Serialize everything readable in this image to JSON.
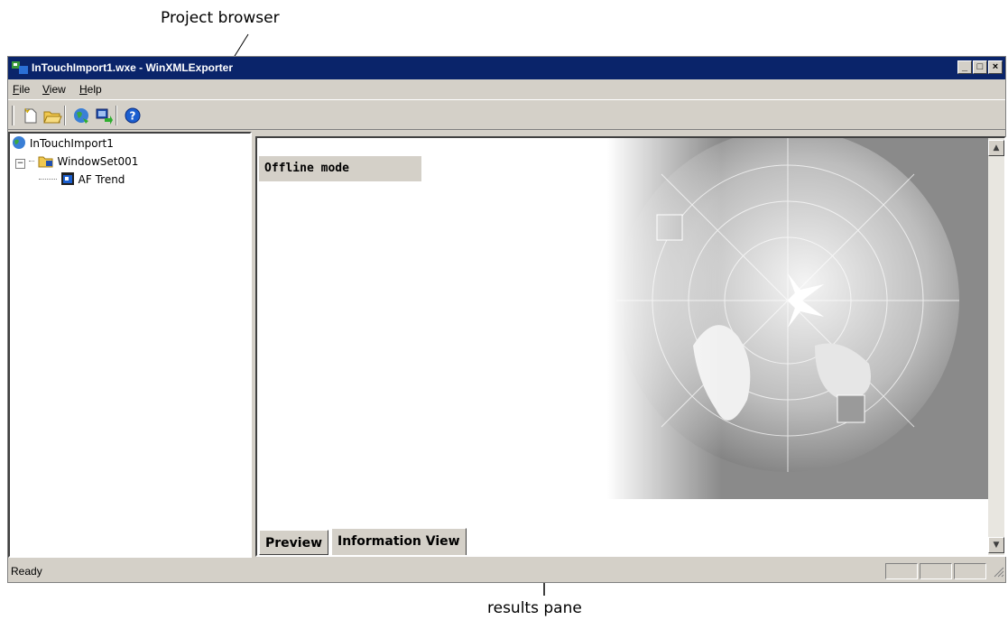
{
  "callouts": {
    "project_browser": "Project browser",
    "results_pane": "results pane"
  },
  "window": {
    "title": "InTouchImport1.wxe - WinXMLExporter",
    "controls": {
      "minimize": "_",
      "maximize": "□",
      "close": "×"
    }
  },
  "menu": [
    {
      "label": "File",
      "accel": "F",
      "rest": "ile"
    },
    {
      "label": "View",
      "accel": "V",
      "rest": "iew"
    },
    {
      "label": "Help",
      "accel": "H",
      "rest": "elp"
    }
  ],
  "toolbar": {
    "icons": [
      "new-document-icon",
      "open-folder-icon",
      "globe-connect-icon",
      "export-icon",
      "help-icon"
    ]
  },
  "tree": {
    "root": "InTouchImport1",
    "folder": "WindowSet001",
    "leaf": "AF Trend",
    "expander": "−"
  },
  "results": {
    "mode_label": "Offline mode"
  },
  "tabs": [
    {
      "label": "Preview"
    },
    {
      "label": "Information View"
    }
  ],
  "status": {
    "text": "Ready"
  },
  "colors": {
    "titlebar": "#0a246a",
    "chrome": "#d4d0c8"
  }
}
